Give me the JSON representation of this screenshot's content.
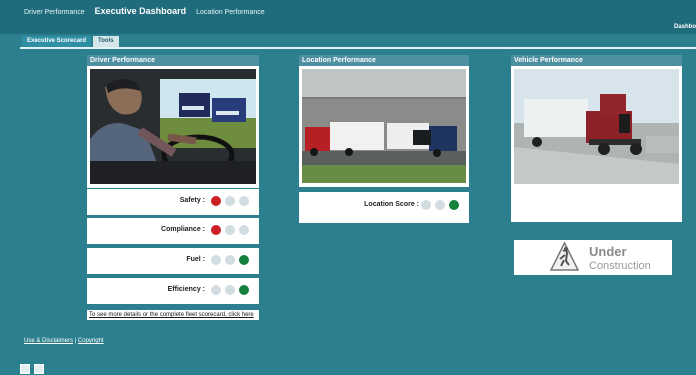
{
  "top_nav": {
    "driver_performance": "Driver Performance",
    "executive_dashboard": "Executive Dashboard",
    "location_performance": "Location Performance",
    "right_label": "Dashbo"
  },
  "tabs": [
    {
      "label": "Executive Scorecard",
      "active": true
    },
    {
      "label": "Tools",
      "active": false
    }
  ],
  "panels": {
    "driver": {
      "title": "Driver Performance"
    },
    "location": {
      "title": "Location Performance",
      "score_label": "Location Score :"
    },
    "vehicle": {
      "title": "Vehicle Performance"
    }
  },
  "driver_metrics": [
    {
      "label": "Safety :",
      "dots": [
        "red",
        "grey",
        "grey"
      ]
    },
    {
      "label": "Compliance :",
      "dots": [
        "red",
        "grey",
        "grey"
      ]
    },
    {
      "label": "Fuel :",
      "dots": [
        "grey",
        "grey",
        "green"
      ]
    },
    {
      "label": "Efficiency :",
      "dots": [
        "grey",
        "grey",
        "green"
      ]
    }
  ],
  "location_score_dots": [
    "grey",
    "grey",
    "green"
  ],
  "under_construction": {
    "line1": "Under",
    "line2": "Construction"
  },
  "details_link": "To see more details or the complete fleet scorecard, click here",
  "footer": {
    "use_disclaimers": "Use & Disclaimers",
    "separator": "|",
    "copyright": "Copyright"
  },
  "icons": [
    "refresh-icon",
    "print-icon",
    "warning-sign-icon"
  ]
}
